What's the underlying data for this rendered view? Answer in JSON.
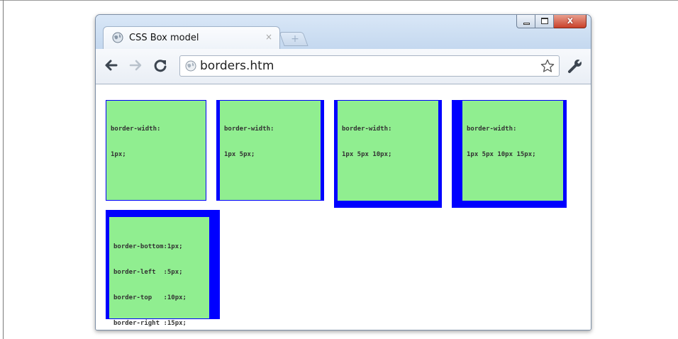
{
  "browser": {
    "tab": {
      "title": "CSS Box model",
      "close_glyph": "×"
    },
    "new_tab_glyph": "+",
    "window_buttons": {
      "minimize": "",
      "maximize": "",
      "close": "x"
    },
    "address": "borders.htm",
    "icons": [
      "globe-icon",
      "back-arrow-icon",
      "forward-arrow-icon",
      "reload-icon",
      "star-icon",
      "wrench-icon"
    ]
  },
  "boxes": [
    {
      "lines": [
        "border-width:",
        "1px;"
      ]
    },
    {
      "lines": [
        "border-width:",
        "1px 5px;"
      ]
    },
    {
      "lines": [
        "border-width:",
        "1px 5px 10px;"
      ]
    },
    {
      "lines": [
        "border-width:",
        "1px 5px 10px 15px;"
      ]
    },
    {
      "lines": [
        "border-bottom:1px;",
        "border-left  :5px;",
        "border-top   :10px;",
        "border-right :15px;"
      ]
    }
  ],
  "colors": {
    "box_fill": "#90ee90",
    "border": "#0000ff",
    "chrome": "#c9dcf2"
  }
}
